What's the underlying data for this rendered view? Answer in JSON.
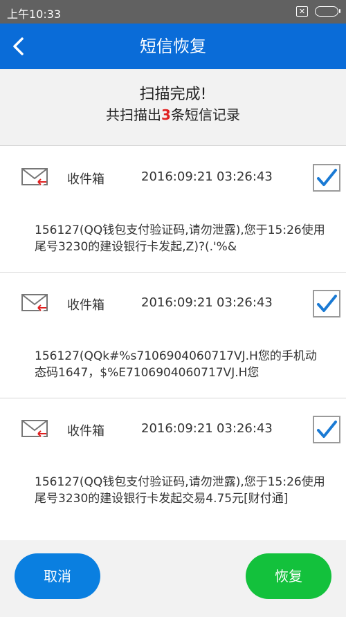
{
  "status_bar": {
    "time": "上午10:33",
    "sim_icon": "sim-x-icon",
    "battery_icon": "battery-icon"
  },
  "app_bar": {
    "title": "短信恢复",
    "back_icon": "back-chevron-icon"
  },
  "summary": {
    "line1": "扫描完成!",
    "line2_prefix": "共扫描出",
    "count": "3",
    "line2_suffix": "条短信记录",
    "count_color": "#e02020"
  },
  "messages": [
    {
      "folder": "收件箱",
      "date": "2016:09:21",
      "time": "03:26:43",
      "checked": true,
      "body": "156127(QQ钱包支付验证码,请勿泄露),您于15:26使用尾号3230的建设银行卡发起,Z)?(.'%&"
    },
    {
      "folder": "收件箱",
      "date": "2016:09:21",
      "time": "03:26:43",
      "checked": true,
      "body": "156127(QQk#%s7106904060717VJ.H您的手机动态码1647，$%E7106904060717VJ.H您"
    },
    {
      "folder": "收件箱",
      "date": "2016:09:21",
      "time": "03:26:43",
      "checked": true,
      "body": "156127(QQ钱包支付验证码,请勿泄露),您于15:26使用尾号3230的建设银行卡发起交易4.75元[财付通]"
    }
  ],
  "buttons": {
    "cancel": "取消",
    "restore": "恢复"
  },
  "colors": {
    "primary": "#0a6cd8",
    "cancel": "#0a7fe0",
    "restore": "#13c13c"
  }
}
